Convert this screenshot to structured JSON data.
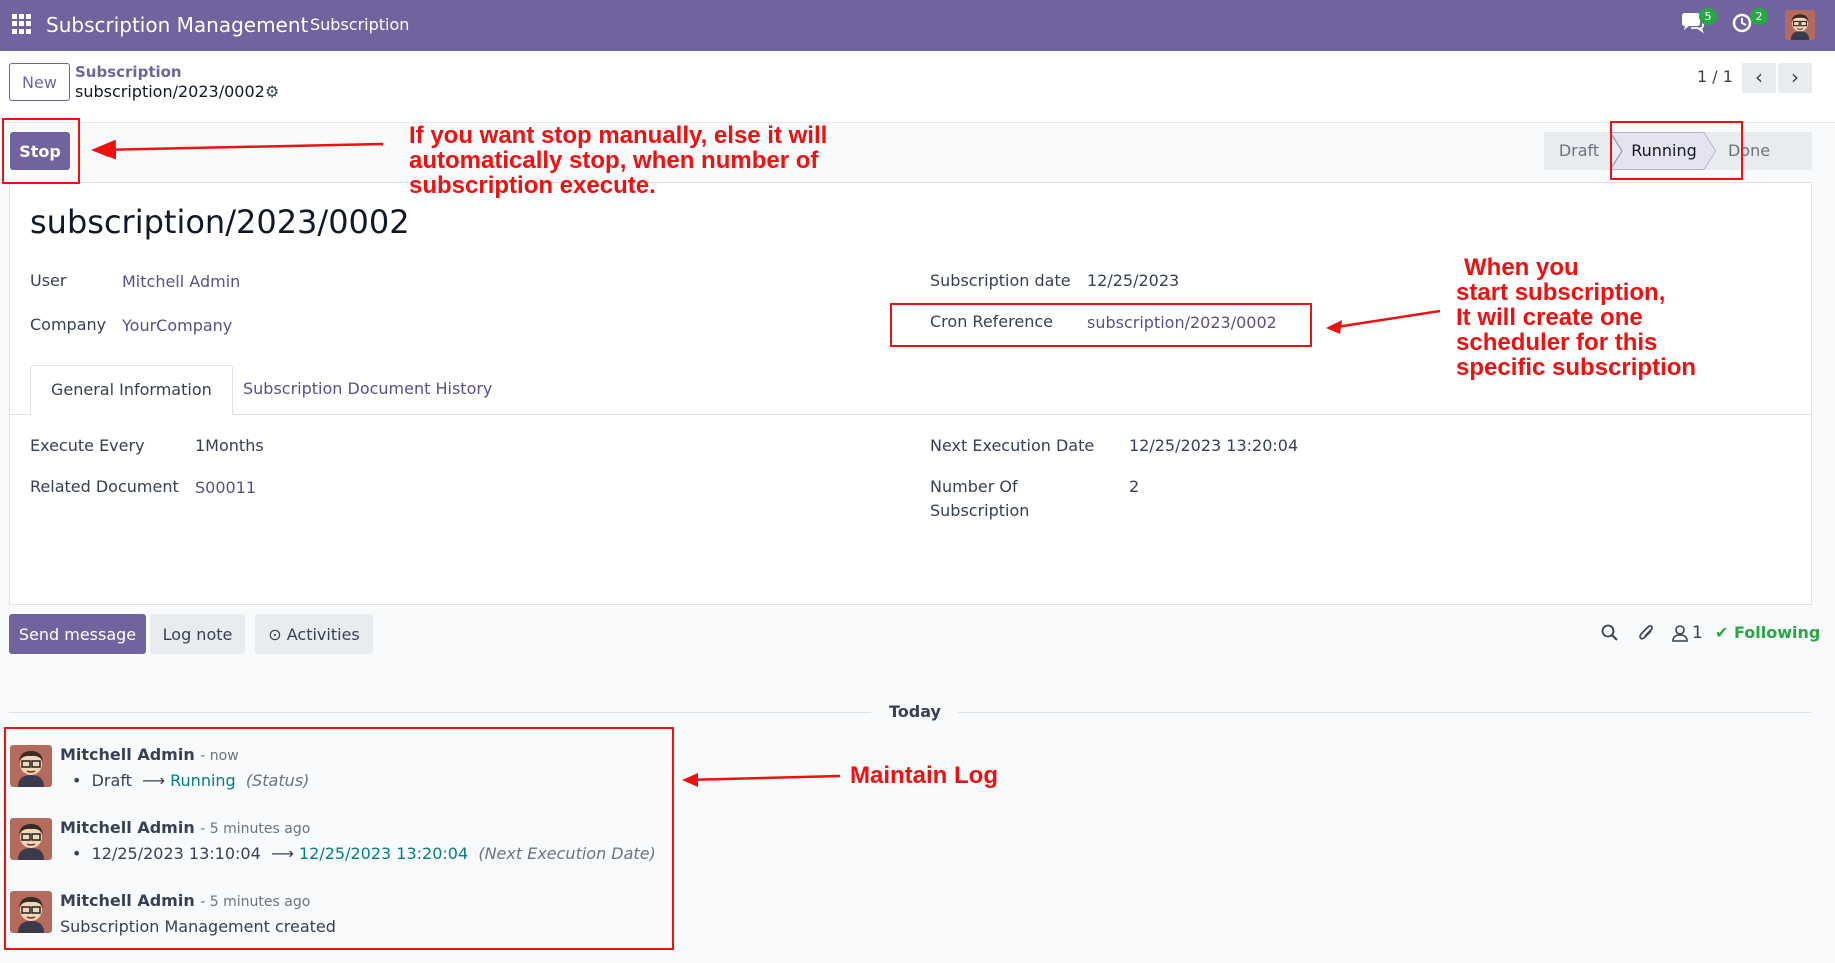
{
  "navbar": {
    "app_title": "Subscription Management",
    "menu": "Subscription",
    "messages_badge": "5",
    "activities_badge": "2"
  },
  "control_panel": {
    "new_button": "New",
    "breadcrumb_parent": "Subscription",
    "breadcrumb_current": "subscription/2023/0002",
    "pager": "1 / 1"
  },
  "statusbar": {
    "stop_button": "Stop",
    "stages": [
      "Draft",
      "Running",
      "Done"
    ],
    "current_stage": "Running"
  },
  "form": {
    "title": "subscription/2023/0002",
    "user_label": "User",
    "user_value": "Mitchell Admin",
    "company_label": "Company",
    "company_value": "YourCompany",
    "subscription_date_label": "Subscription date",
    "subscription_date_value": "12/25/2023",
    "cron_label": "Cron Reference",
    "cron_value": "subscription/2023/0002",
    "tabs": [
      "General Information",
      "Subscription Document History"
    ],
    "execute_every_label": "Execute Every",
    "execute_every_value": "1Months",
    "related_doc_label": "Related Document",
    "related_doc_value": "S00011",
    "next_exec_label": "Next Execution Date",
    "next_exec_value": "12/25/2023 13:20:04",
    "num_sub_label_1": "Number Of",
    "num_sub_label_2": "Subscription",
    "num_sub_value": "2"
  },
  "chatter": {
    "send_message": "Send message",
    "log_note": "Log note",
    "activities": "Activities",
    "followers_count": "1",
    "following": "Following",
    "today": "Today",
    "messages": [
      {
        "author": "Mitchell Admin",
        "time": "- now",
        "old": "Draft",
        "new": "Running",
        "field": "(Status)"
      },
      {
        "author": "Mitchell Admin",
        "time": "- 5 minutes ago",
        "old": "12/25/2023 13:10:04",
        "new": "12/25/2023 13:20:04",
        "field": "(Next Execution Date)"
      },
      {
        "author": "Mitchell Admin",
        "time": "- 5 minutes ago",
        "text": "Subscription Management created"
      }
    ]
  },
  "annotations": {
    "stop_note": [
      "If you want stop manually, else it will",
      "automatically stop, when number of",
      "subscription execute."
    ],
    "cron_note": [
      "When you",
      "start subscription,",
      "It will create one",
      "scheduler for this",
      "specific subscription"
    ],
    "log_note": "Maintain Log"
  },
  "colors": {
    "brand": "#71639e",
    "annotation": "#ee1111",
    "success": "#28a745",
    "teal": "#017e84"
  }
}
